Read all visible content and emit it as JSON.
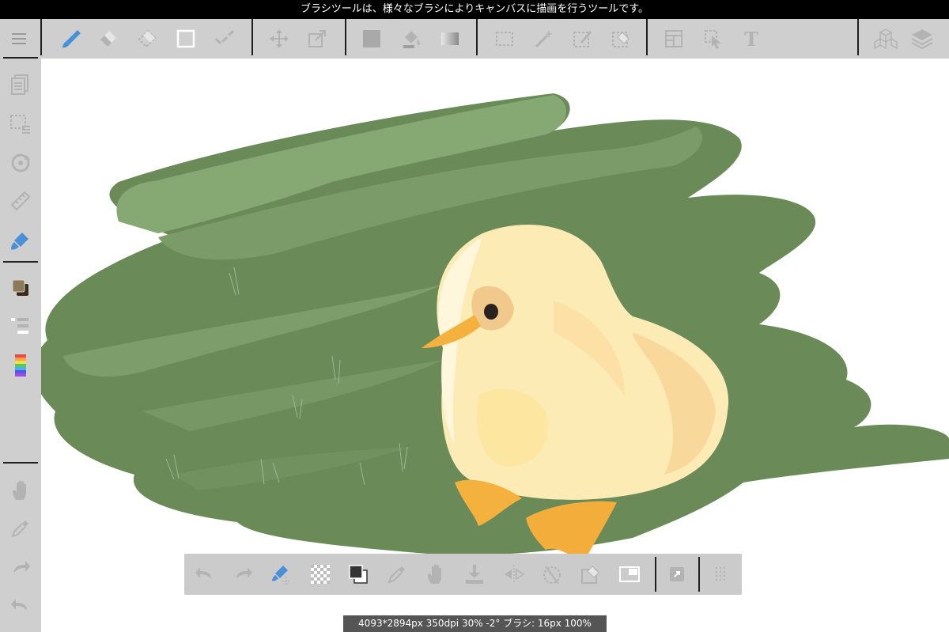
{
  "tooltip": "ブラシツールは、様々なブラシによりキャンバスに描画を行うツールです。",
  "status": "4093*2894px 350dpi 30% -2° ブラシ: 16px 100%",
  "top_toolbar": {
    "items": [
      "menu-icon",
      "brush-icon",
      "eraser-icon",
      "blur-eraser-icon",
      "shape-icon",
      "dot-icon",
      "move-icon",
      "transform-icon",
      "fill-color-icon",
      "bucket-icon",
      "gradient-icon",
      "select-rect-icon",
      "magic-wand-icon",
      "select-pen-icon",
      "select-eraser-icon",
      "frame-divide-icon",
      "select-arrow-icon",
      "text-icon",
      "material-icon",
      "layers-icon"
    ],
    "text_tool_glyph": "T"
  },
  "left_sidebar": {
    "items": [
      "pages-icon",
      "selection-menu-icon",
      "rotate-icon",
      "ruler-icon",
      "brush-settings-icon",
      "color-icon",
      "brush-list-icon",
      "color-palette-icon",
      "hand-icon",
      "eyedropper-icon",
      "redo-icon",
      "undo-icon"
    ]
  },
  "bottom_toolbar": {
    "items": [
      "undo-icon",
      "redo-icon",
      "snap-icon",
      "transparent-icon",
      "color-swap-icon",
      "eyedropper-icon",
      "hand-icon",
      "download-icon",
      "flip-icon",
      "rotate-reset-icon",
      "clear-icon",
      "fit-screen-icon",
      "fullscreen-icon",
      "grip-icon"
    ]
  },
  "colors": {
    "foreground": "#8c7a56",
    "background": "#3b2a1a",
    "accent_brush": "#4a90d9",
    "toolbar_bg": "#cfcfcf",
    "grass_light": "#86a873",
    "grass_dark": "#6a8a58",
    "chick": "#fbe9b0",
    "beak": "#f5b13e"
  }
}
